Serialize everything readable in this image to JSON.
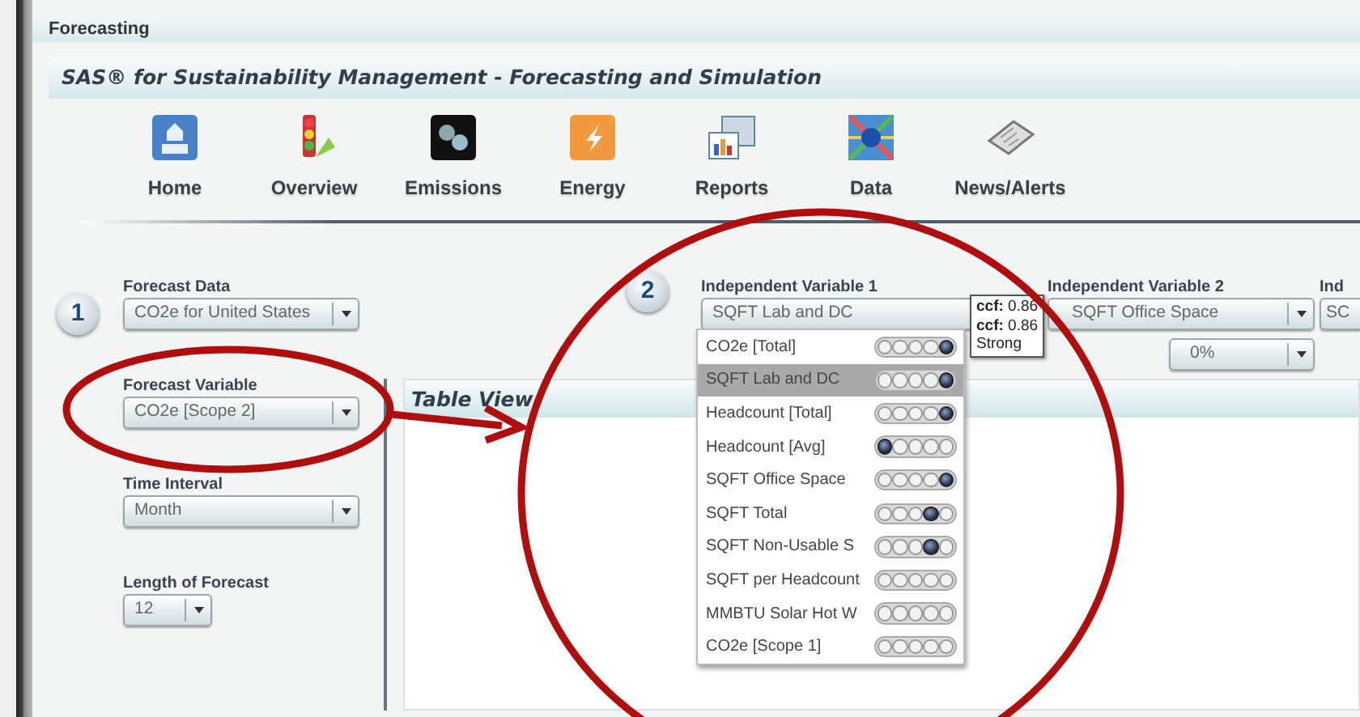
{
  "window": {
    "title": "Forecasting"
  },
  "app_header": {
    "title": "SAS® for Sustainability Management - Forecasting and Simulation"
  },
  "nav": [
    {
      "label": "Home",
      "kind": "home"
    },
    {
      "label": "Overview",
      "kind": "overview"
    },
    {
      "label": "Emissions",
      "kind": "emissions"
    },
    {
      "label": "Energy",
      "kind": "energy"
    },
    {
      "label": "Reports",
      "kind": "reports"
    },
    {
      "label": "Data",
      "kind": "data"
    },
    {
      "label": "News/Alerts",
      "kind": "news"
    }
  ],
  "step_1": {
    "number": "1",
    "fields": [
      {
        "label": "Forecast Data",
        "value": "CO2e for United States"
      },
      {
        "label": "Forecast Variable",
        "value": "CO2e [Scope 2]"
      },
      {
        "label": "Time Interval",
        "value": "Month"
      },
      {
        "label": "Length of Forecast",
        "value": "12"
      }
    ]
  },
  "step_2": {
    "number": "2",
    "variables": [
      {
        "label": "Independent Variable 1",
        "value": "SQFT Lab and DC"
      },
      {
        "label": "Independent Variable 2",
        "value": "SQFT Office Space",
        "percent": "0%"
      },
      {
        "label": "Ind",
        "value": "SC"
      }
    ]
  },
  "dropdown_list": {
    "items": [
      {
        "label": "CO2e [Total]",
        "selected": false,
        "dots": [
          false,
          false,
          false,
          false,
          true
        ]
      },
      {
        "label": "SQFT Lab and DC",
        "selected": true,
        "dots": [
          false,
          false,
          false,
          false,
          true
        ]
      },
      {
        "label": "Headcount [Total]",
        "selected": false,
        "dots": [
          false,
          false,
          false,
          false,
          true
        ]
      },
      {
        "label": "Headcount [Avg]",
        "selected": false,
        "dots": [
          true,
          false,
          false,
          false,
          false
        ]
      },
      {
        "label": "SQFT Office Space",
        "selected": false,
        "dots": [
          false,
          false,
          false,
          false,
          true
        ]
      },
      {
        "label": "SQFT Total",
        "selected": false,
        "dots": [
          false,
          false,
          false,
          true,
          false
        ]
      },
      {
        "label": "SQFT Non-Usable S",
        "selected": false,
        "dots": [
          false,
          false,
          false,
          true,
          false
        ]
      },
      {
        "label": "SQFT per Headcount",
        "selected": false,
        "dots": [
          false,
          false,
          false,
          false,
          false
        ]
      },
      {
        "label": "MMBTU Solar Hot W",
        "selected": false,
        "dots": [
          false,
          false,
          false,
          false,
          false
        ]
      },
      {
        "label": "CO2e [Scope 1]",
        "selected": false,
        "dots": [
          false,
          false,
          false,
          false,
          false
        ]
      }
    ]
  },
  "tooltip": {
    "lines": [
      "**ccf:** 0.86",
      "**ccf:** 0.86",
      "Strong"
    ]
  },
  "table_view": {
    "title": "Table View"
  },
  "annotations": [
    {
      "kind": "ellipse"
    },
    {
      "kind": "ellipse"
    },
    {
      "kind": "arrow"
    }
  ]
}
